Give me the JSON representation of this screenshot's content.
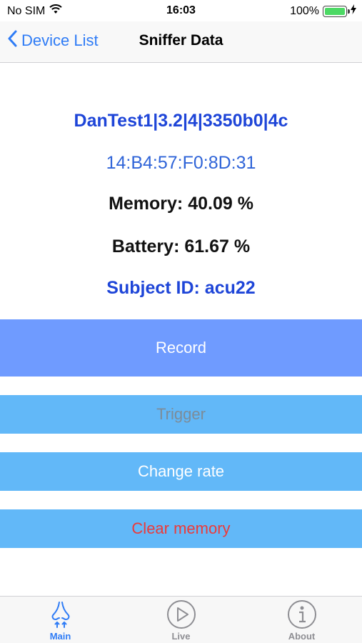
{
  "status_bar": {
    "carrier": "No SIM",
    "time": "16:03",
    "battery_percent": "100%",
    "battery_level": 1.0
  },
  "nav": {
    "back_label": "Device List",
    "title": "Sniffer Data"
  },
  "device": {
    "name": "DanTest1|3.2|4|3350b0|4c",
    "mac": "14:B4:57:F0:8D:31",
    "memory": "Memory: 40.09 %",
    "battery": "Battery: 61.67 %",
    "subject": "Subject ID: acu22"
  },
  "buttons": {
    "record": "Record",
    "trigger": "Trigger",
    "change_rate": "Change rate",
    "clear_memory": "Clear memory"
  },
  "tabs": [
    {
      "label": "Main",
      "icon": "nose-icon",
      "active": true
    },
    {
      "label": "Live",
      "icon": "play-icon",
      "active": false
    },
    {
      "label": "About",
      "icon": "info-icon",
      "active": false
    }
  ],
  "colors": {
    "accent": "#2f7cf6",
    "record_button": "#6f9bff",
    "action_button": "#62b8f8",
    "danger_text": "#ec3a3a",
    "device_blue": "#1e45d8"
  }
}
